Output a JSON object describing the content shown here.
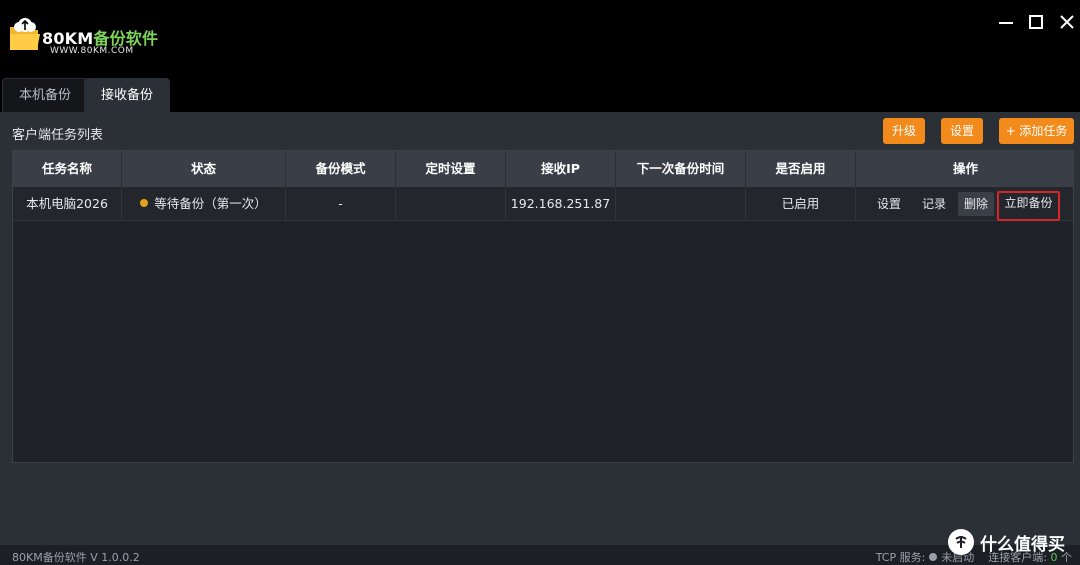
{
  "window": {
    "app_name_prefix": "80KM",
    "app_name_suffix": "备份软件",
    "app_url": "WWW.80KM.COM"
  },
  "tabs": [
    {
      "label": "本机备份",
      "active": false
    },
    {
      "label": "接收备份",
      "active": true
    }
  ],
  "section_title": "客户端任务列表",
  "toolbar": {
    "upgrade_label": "升级",
    "settings_label": "设置",
    "add_task_label": "+ 添加任务"
  },
  "table": {
    "columns": [
      "任务名称",
      "状态",
      "备份模式",
      "定时设置",
      "接收IP",
      "下一次备份时间",
      "是否启用",
      "操作"
    ],
    "rows": [
      {
        "name": "本机电脑2026",
        "status": "等待备份（第一次）",
        "mode": "-",
        "schedule": "",
        "ip": "192.168.251.87",
        "next_time": "",
        "enabled": "已启用",
        "actions": {
          "settings": "设置",
          "log": "记录",
          "delete": "删除",
          "backup_now": "立即备份"
        }
      }
    ]
  },
  "statusbar": {
    "version": "80KM备份软件 V 1.0.0.2",
    "tcp_label": "TCP 服务:",
    "tcp_status": "未启动",
    "clients_label": "连接客户端:",
    "clients_count": "0",
    "clients_unit": "个"
  },
  "watermark": {
    "text": "什么值得买"
  },
  "colors": {
    "accent_orange": "#f28b1c",
    "status_waiting": "#e3a21a",
    "highlight_red": "#d62828",
    "brand_green": "#7ed35a"
  }
}
